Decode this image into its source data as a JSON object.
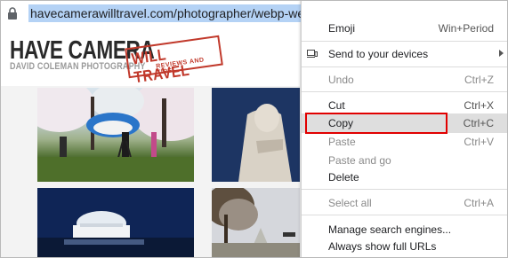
{
  "address_bar": {
    "url": "havecamerawilltravel.com/photographer/webp-website/"
  },
  "site_header": {
    "logo_main": "HAVE CAMERA",
    "logo_sub": "DAVID COLEMAN PHOTOGRAPHY",
    "stamp_title": "WILL TRAVEL",
    "stamp_sub": "REVIEWS AND TIPS",
    "stamp_color": "#c1392b"
  },
  "context_menu": {
    "items": [
      {
        "label": "Emoji",
        "shortcut": "Win+Period",
        "disabled": false
      },
      {
        "label": "Send to your devices",
        "shortcut": "",
        "disabled": false,
        "icon": "devices-icon",
        "submenu": true
      },
      {
        "label": "Undo",
        "shortcut": "Ctrl+Z",
        "disabled": true
      },
      {
        "label": "Cut",
        "shortcut": "Ctrl+X",
        "disabled": false
      },
      {
        "label": "Copy",
        "shortcut": "Ctrl+C",
        "disabled": false,
        "highlighted": true
      },
      {
        "label": "Paste",
        "shortcut": "Ctrl+V",
        "disabled": true
      },
      {
        "label": "Paste and go",
        "shortcut": "",
        "disabled": true
      },
      {
        "label": "Delete",
        "shortcut": "",
        "disabled": false
      },
      {
        "label": "Select all",
        "shortcut": "Ctrl+A",
        "disabled": true
      },
      {
        "label": "Manage search engines...",
        "shortcut": "",
        "disabled": false
      },
      {
        "label": "Always show full URLs",
        "shortcut": "",
        "disabled": false
      }
    ],
    "annotation_color": "#e10000",
    "highlight_color": "#dedede"
  }
}
